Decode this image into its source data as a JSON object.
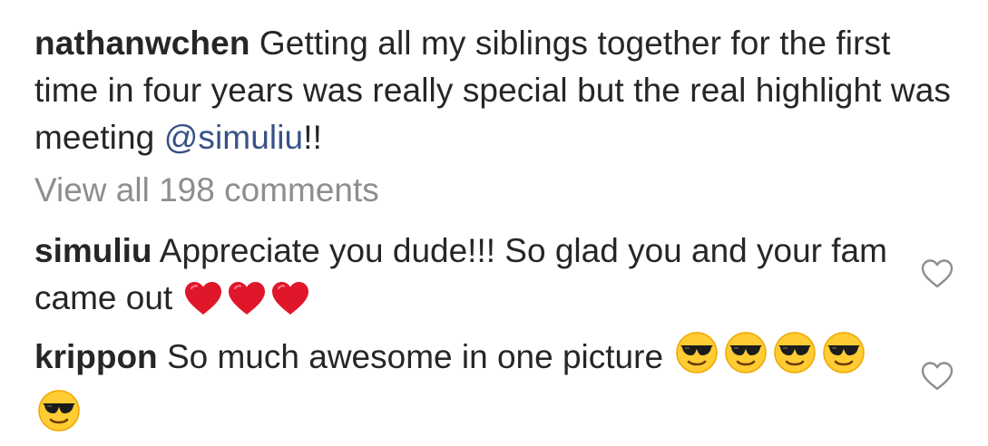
{
  "post": {
    "caption": {
      "username": "nathanwchen",
      "text_before_mention": " Getting all my siblings together for the first time in four years was really special but the real highlight was meeting ",
      "mention": "@simuliu",
      "text_after_mention": "!!"
    },
    "view_all_comments": "View all 198 comments"
  },
  "comments": [
    {
      "username": "simuliu",
      "text": " Appreciate you dude!!! So glad you and your fam came out ",
      "emojis": [
        "red-heart",
        "red-heart",
        "red-heart"
      ],
      "liked": false
    },
    {
      "username": "krippon",
      "text": " So much awesome in one picture ",
      "emojis": [
        "smiling-face-with-sunglasses",
        "smiling-face-with-sunglasses",
        "smiling-face-with-sunglasses",
        "smiling-face-with-sunglasses",
        "smiling-face-with-sunglasses"
      ],
      "liked": false
    }
  ],
  "colors": {
    "text": "#262626",
    "secondary_text": "#8e8e8e",
    "mention": "#385185",
    "heart_emoji": "#e0162b",
    "sunglasses_face": "#ffcc33",
    "like_outline": "#8e8e8e"
  }
}
